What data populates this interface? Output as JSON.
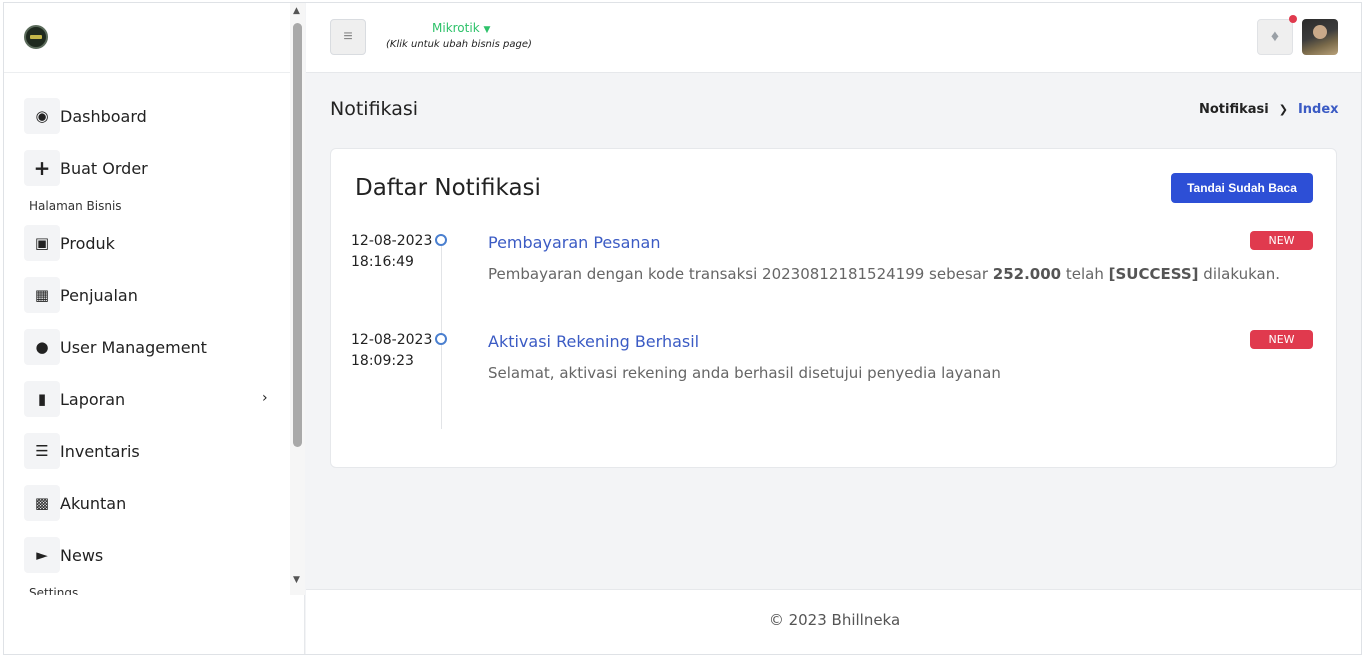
{
  "sidebar": {
    "items": [
      {
        "label": "Dashboard",
        "icon": "dashboard-icon"
      },
      {
        "label": "Buat Order",
        "icon": "plus-icon"
      },
      {
        "label": "Produk",
        "icon": "box-icon"
      },
      {
        "label": "Penjualan",
        "icon": "cart-icon"
      },
      {
        "label": "User Management",
        "icon": "users-icon"
      },
      {
        "label": "Laporan",
        "icon": "file-icon"
      },
      {
        "label": "Inventaris",
        "icon": "inventory-icon"
      },
      {
        "label": "Akuntan",
        "icon": "money-icon"
      },
      {
        "label": "News",
        "icon": "megaphone-icon"
      }
    ],
    "headers": {
      "business": "Halaman Bisnis",
      "settings": "Settings"
    }
  },
  "topbar": {
    "business_name": "Mikrotik",
    "business_hint": "(Klik untuk ubah bisnis page)"
  },
  "page": {
    "title": "Notifikasi",
    "breadcrumb": [
      "Notifikasi",
      "Index"
    ]
  },
  "card": {
    "title": "Daftar Notifikasi",
    "mark_read_label": "Tandai Sudah Baca"
  },
  "notifications": [
    {
      "date": "12-08-2023",
      "time": "18:16:49",
      "title": "Pembayaran Pesanan",
      "badge": "NEW",
      "body_parts": [
        "Pembayaran dengan kode transaksi 20230812181524199 sebesar ",
        "252.000",
        " telah ",
        "[SUCCESS]",
        " dilakukan."
      ]
    },
    {
      "date": "12-08-2023",
      "time": "18:09:23",
      "title": "Aktivasi Rekening Berhasil",
      "badge": "NEW",
      "body": "Selamat, aktivasi rekening anda berhasil disetujui penyedia layanan"
    }
  ],
  "footer": {
    "text": "© 2023 Bhillneka"
  },
  "colors": {
    "primary": "#2d4fd6",
    "link": "#3b5bc4",
    "badge": "#e03a4e",
    "business": "#2ec26a"
  }
}
